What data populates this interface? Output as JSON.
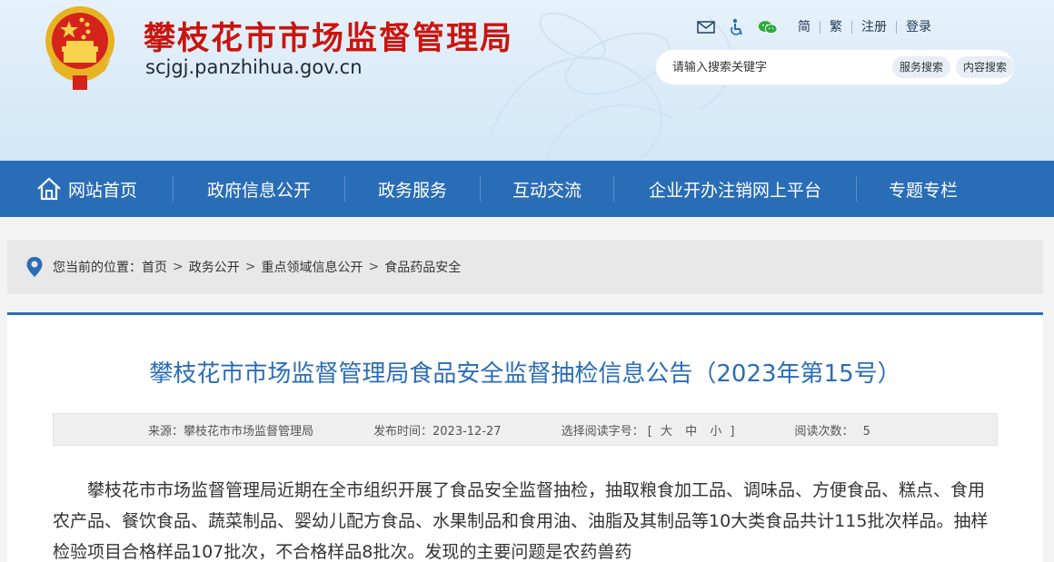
{
  "header": {
    "site_title": "攀枝花市市场监督管理局",
    "site_domain": "scjgj.panzhihua.gov.cn",
    "top_links": [
      "简",
      "繁",
      "注册",
      "登录"
    ],
    "icons": [
      "mail-icon",
      "accessibility-icon",
      "wechat-icon"
    ],
    "search": {
      "placeholder": "请输入搜索关键字",
      "service_button": "服务搜索",
      "content_button": "内容搜索"
    }
  },
  "nav": {
    "items": [
      "网站首页",
      "政府信息公开",
      "政务服务",
      "互动交流",
      "企业开办注销网上平台",
      "专题专栏"
    ]
  },
  "breadcrumb": {
    "label": "您当前的位置：",
    "items": [
      "首页",
      "政务公开",
      "重点领域信息公开",
      "食品药品安全"
    ],
    "separator": ">"
  },
  "article": {
    "title": "攀枝花市市场监督管理局食品安全监督抽检信息公告（2023年第15号）",
    "meta": {
      "source": "来源：攀枝花市市场监督管理局",
      "date": "发布时间：2023-12-27",
      "font_size_label": "选择阅读字号：",
      "font_open": "[",
      "font_sizes": [
        "大",
        "中",
        "小"
      ],
      "font_close": "]",
      "views_label": "阅读次数：",
      "views": "5"
    },
    "body": "攀枝花市市场监督管理局近期在全市组织开展了食品安全监督抽检，抽取粮食加工品、调味品、方便食品、糕点、食用农产品、餐饮食品、蔬菜制品、婴幼儿配方食品、水果制品和食用油、油脂及其制品等10大类食品共计115批次样品。抽样检验项目合格样品107批次，不合格样品8批次。发现的主要问题是农药兽药"
  },
  "colors": {
    "title_red": "#c9150e",
    "nav_blue": "#2a6db7",
    "article_title_blue": "#2a6db7"
  }
}
